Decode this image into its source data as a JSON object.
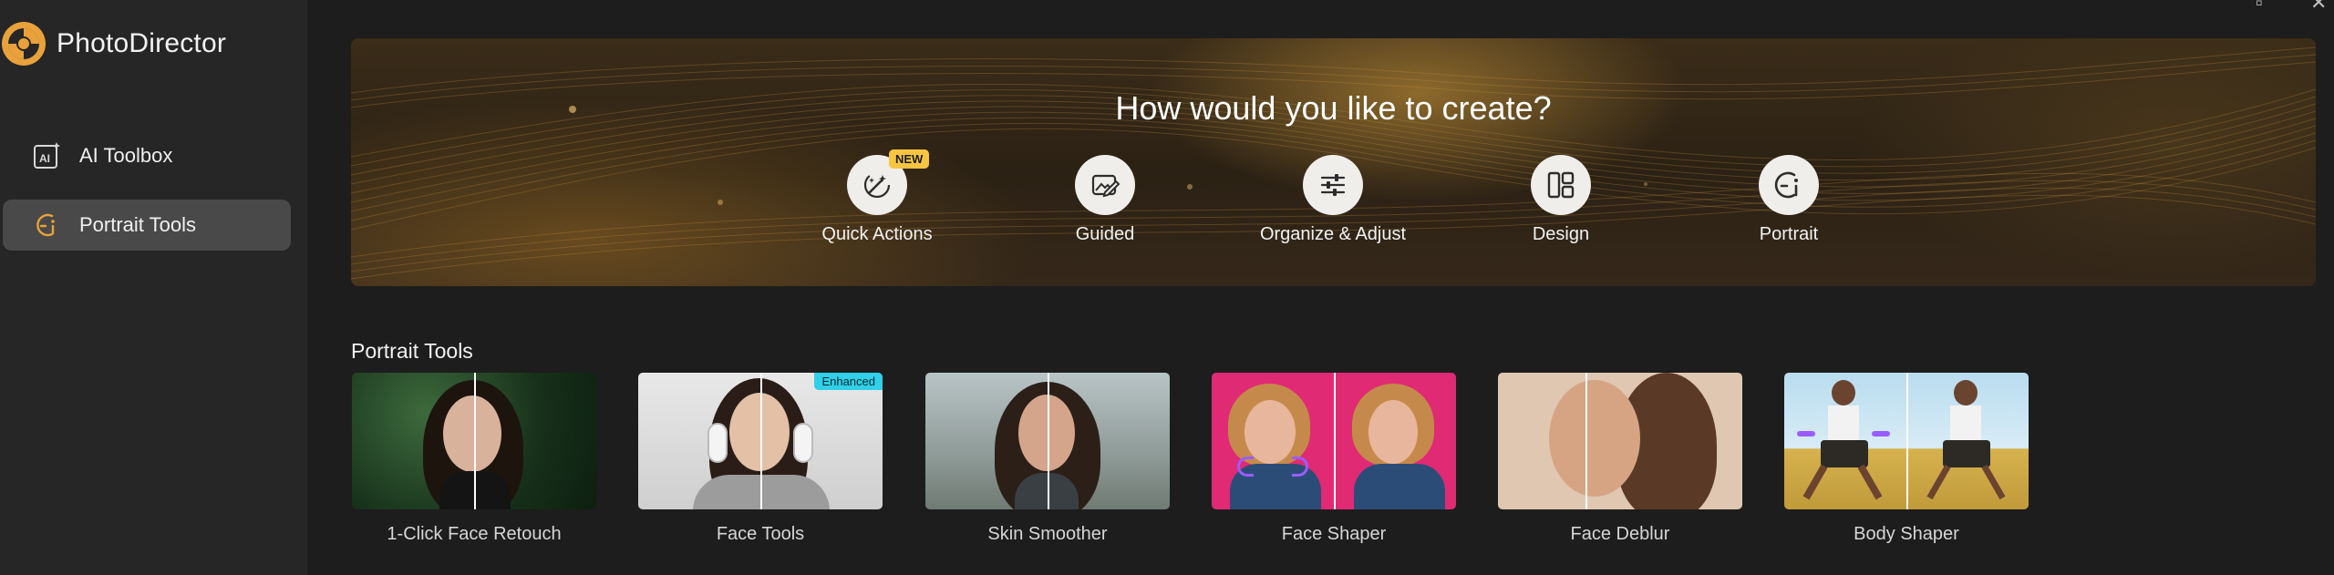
{
  "app": {
    "name": "PhotoDirector"
  },
  "sidebar": {
    "items": [
      {
        "label": "AI Toolbox",
        "icon": "ai-toolbox-icon",
        "active": false
      },
      {
        "label": "Portrait Tools",
        "icon": "portrait-icon",
        "active": true
      }
    ]
  },
  "banner": {
    "title": "How would you like to create?",
    "actions": [
      {
        "label": "Quick Actions",
        "icon": "magic-wand-icon",
        "badge": "NEW"
      },
      {
        "label": "Guided",
        "icon": "guided-edit-icon"
      },
      {
        "label": "Organize & Adjust",
        "icon": "sliders-icon"
      },
      {
        "label": "Design",
        "icon": "layout-icon"
      },
      {
        "label": "Portrait",
        "icon": "portrait-icon"
      }
    ]
  },
  "section": {
    "title": "Portrait Tools",
    "tools": [
      {
        "label": "1-Click Face Retouch"
      },
      {
        "label": "Face Tools",
        "badge": "Enhanced"
      },
      {
        "label": "Skin Smoother"
      },
      {
        "label": "Face Shaper"
      },
      {
        "label": "Face Deblur"
      },
      {
        "label": "Body Shaper"
      }
    ]
  },
  "colors": {
    "accent": "#e9a23b",
    "sidebar_active": "#494949",
    "badge_new": "#f7c541",
    "badge_enhanced": "#2fd0e8"
  }
}
